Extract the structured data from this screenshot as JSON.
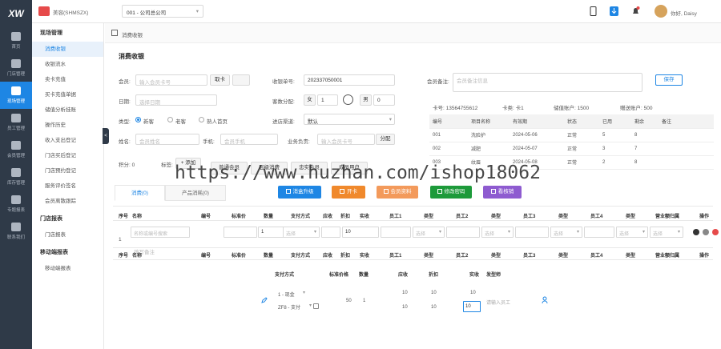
{
  "app": {
    "logo": "XW"
  },
  "rail": [
    {
      "label": "首页"
    },
    {
      "label": "门店管理"
    },
    {
      "label": "现场管理"
    },
    {
      "label": "员工管理"
    },
    {
      "label": "会员管理"
    },
    {
      "label": "库存管理"
    },
    {
      "label": "专题报表"
    },
    {
      "label": "联系我们"
    }
  ],
  "sidebar": {
    "group1": "现场管理",
    "items1": [
      "消费收银",
      "收银流水",
      "卖卡充值",
      "买卡充值单据",
      "储值分析挂账",
      "操作历史",
      "收入支出登记",
      "门店买后登记",
      "门店预约登记",
      "服务评价签名",
      "会员离散跟踪"
    ],
    "group2": "门店报表",
    "items2": [
      "门店报表"
    ],
    "group3": "移动端报表",
    "items3": [
      "移动端报表"
    ],
    "toggle": "<"
  },
  "topbar": {
    "store_name": "美容(SHMSZX)",
    "store_select": "001 - 公司总公司",
    "greeting": "你好, Daisy"
  },
  "breadcrumb": {
    "label": "消费收银"
  },
  "page": {
    "title": "消费收银"
  },
  "form": {
    "member_label": "会员:",
    "member_placeholder": "输入会员卡号",
    "member_btn": "取卡",
    "date_label": "日期:",
    "date_placeholder": "选择日期",
    "type_label": "类型:",
    "type_options": [
      "新客",
      "老客",
      "熟人首页"
    ],
    "name_label": "姓名:",
    "name_placeholder": "会员姓名",
    "phone_label": "手机:",
    "phone_placeholder": "会员手机",
    "points_label": "积分: 0",
    "tag_label": "标签:",
    "tag_add": "+ 添加",
    "order_label": "收银单号:",
    "order_value": "202337050001",
    "assign_label": "客数分配:",
    "female": "女",
    "female_count": "1",
    "male": "男",
    "male_count": "0",
    "source_label": "进店渠道:",
    "source_value": "默认",
    "member_consult_label": "业务负责:",
    "member_consult_placeholder": "输入会员卡号",
    "member_consult_btn": "分配",
    "remark_label": "会员备注:",
    "remark_placeholder": "会员备注信息",
    "save_btn": "保存"
  },
  "group_buttons": [
    "普通会员",
    "层级消费",
    "忠实会员",
    "成员用户"
  ],
  "card_info": {
    "card_no": "卡号: 13564755612",
    "card_type": "卡类: 卡1",
    "balance": "储值账户: 1500",
    "gift": "赠送账户: 500",
    "headers": [
      "编号",
      "项目名称",
      "有效期",
      "状态",
      "已用",
      "剩余",
      "备注"
    ],
    "rows": [
      [
        "001",
        "洗脸护",
        "2024-05-06",
        "正常",
        "5",
        "8",
        ""
      ],
      [
        "002",
        "减肥",
        "2024-05-07",
        "正常",
        "3",
        "7",
        ""
      ],
      [
        "003",
        "纹眉",
        "2024-05-08",
        "正常",
        "2",
        "8",
        ""
      ]
    ]
  },
  "tabs": [
    "消费(0)",
    "产品消耗(0)"
  ],
  "action_buttons": [
    {
      "label": "消盒升级",
      "color": "#1e86e4"
    },
    {
      "label": "开卡",
      "color": "#f0892c"
    },
    {
      "label": "会员资料",
      "color": "#f39a5b"
    },
    {
      "label": "修改密码",
      "color": "#1d9a3a"
    },
    {
      "label": "看核销",
      "color": "#8e5bd0"
    }
  ],
  "grid": {
    "headers": [
      "序号",
      "名称",
      "编号",
      "标准价",
      "数量",
      "支付方式",
      "应收",
      "折扣",
      "实收",
      "员工1",
      "类型",
      "员工2",
      "类型",
      "员工3",
      "类型",
      "员工4",
      "类型",
      "营业额归属",
      "操作"
    ],
    "row_index": "1",
    "name_placeholder": "名称或编号搜索",
    "qty": "1",
    "discount": "10",
    "select_placeholder": "选择",
    "remark": "填写备注"
  },
  "pay": {
    "headers": [
      "支付方式",
      "标准价格",
      "数量",
      "应收",
      "折扣",
      "实收",
      "发型师"
    ],
    "row1": {
      "method": "1 - 现金",
      "std": "50",
      "qty": "1",
      "due": "10",
      "disc": "10",
      "real": "10"
    },
    "row2": {
      "method": "ZF8 - 支付",
      "due": "10",
      "disc": "10",
      "real": "10",
      "staff_placeholder": "请输入员工"
    }
  },
  "watermark": "https://www.huzhan.com/ishop18062"
}
